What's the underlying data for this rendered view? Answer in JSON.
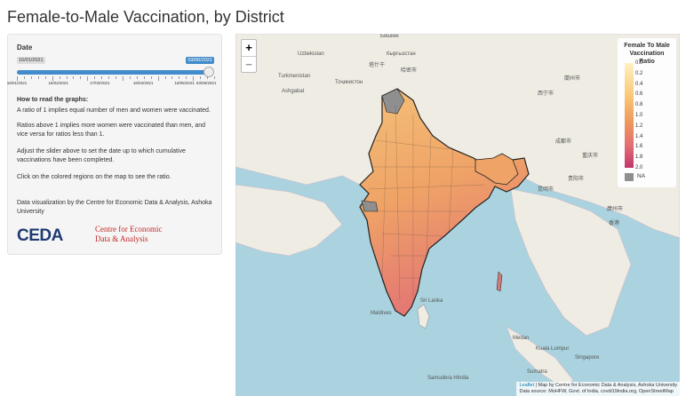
{
  "page": {
    "title": "Female-to-Male Vaccination, by District"
  },
  "sidebar": {
    "date_label": "Date",
    "slider": {
      "from": "16/01/2021",
      "to": "03/06/2021",
      "position": 1.0,
      "ticks": [
        "16/01/2021",
        "15/02/2021",
        "17/03/2021",
        "16/04/2021",
        "16/05/2021",
        "03/06/2021"
      ]
    },
    "howto_title": "How to read the graphs:",
    "paragraphs": [
      "A ratio of 1 implies equal number of men and women were vaccinated.",
      "Ratios above 1 implies more women were vaccinated than men, and vice versa for ratios less than 1.",
      "Adjust the slider above to set the date up to which cumulative vaccinations have been completed.",
      "Click on the colored regions on the map to see the ratio.",
      "Data visualization by the Centre for Economic Data & Analysis, Ashoka University"
    ],
    "logo": {
      "mark": "CEDA",
      "line1": "Centre for Economic",
      "line2": "Data & Analysis"
    }
  },
  "map": {
    "zoom_in": "+",
    "zoom_out": "−",
    "legend": {
      "title": "Female To Male Vaccination Ratio",
      "ticks": [
        "0.0",
        "0.2",
        "0.4",
        "0.6",
        "0.8",
        "1.0",
        "1.2",
        "1.4",
        "1.6",
        "1.8",
        "2.0"
      ],
      "na_label": "NA",
      "colors": [
        "#fff2c2",
        "#f9c978",
        "#ef9b5c",
        "#e16b74",
        "#c2366b"
      ],
      "na_color": "#8f8f8f"
    },
    "place_labels": [
      "Бишкек",
      "Uzbekistan",
      "Кыргызстан",
      "Turkmenistan",
      "Ashgabat",
      "Тоҷикистон",
      "塔什干",
      "哈密市",
      "西宁市",
      "蘭州市",
      "成都市",
      "重庆市",
      "贵阳市",
      "昆明市",
      "廣州市",
      "香港",
      "Sri Lanka",
      "Maldives",
      "Medan",
      "Kuala Lumpur",
      "Singapore",
      "Sumatra",
      "Samudera Hindia"
    ],
    "attribution_link": "Leaflet",
    "attribution_line1": "| Map by Centre for Economic Data & Analysis, Ashoka University",
    "attribution_line2": "Data source: MoHFW, Govt. of India, covid19india.org, OpenStreetMap"
  }
}
